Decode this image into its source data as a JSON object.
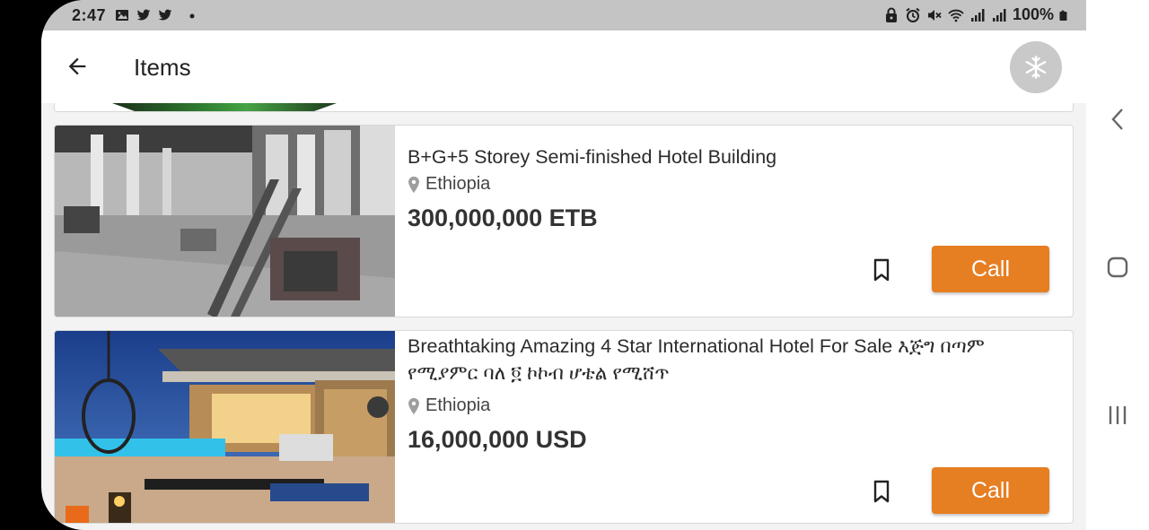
{
  "status_bar": {
    "time": "2:47",
    "battery": "100%",
    "left_icons": [
      "image-icon",
      "twitter-icon",
      "twitter-icon",
      "dot-icon"
    ],
    "right_icons": [
      "lock-icon",
      "alarm-icon",
      "mute-icon",
      "wifi-icon",
      "signal-icon",
      "signal-icon",
      "battery-icon"
    ]
  },
  "app_bar": {
    "title": "Items",
    "back_icon": "arrow-left-icon",
    "action_icon": "snowflake-icon"
  },
  "colors": {
    "accent": "#e67e22",
    "status_bar": "#c4c4c4",
    "action_button": "#c9c9c9"
  },
  "items": [
    {
      "title": "B+G+5 Storey Semi-finished Hotel Building",
      "location": "Ethiopia",
      "price": "300,000,000 ETB",
      "call_label": "Call"
    },
    {
      "title": "Breathtaking Amazing 4 Star International Hotel For Sale እጅግ በጣም የሚያምር ባለ ፬ ኮኮብ ሆቴል የሚሸጥ",
      "location": "Ethiopia",
      "price": "16,000,000 USD",
      "call_label": "Call"
    }
  ],
  "nav_bar": {
    "icons": [
      "back-chevron-icon",
      "home-icon",
      "recents-icon"
    ]
  }
}
